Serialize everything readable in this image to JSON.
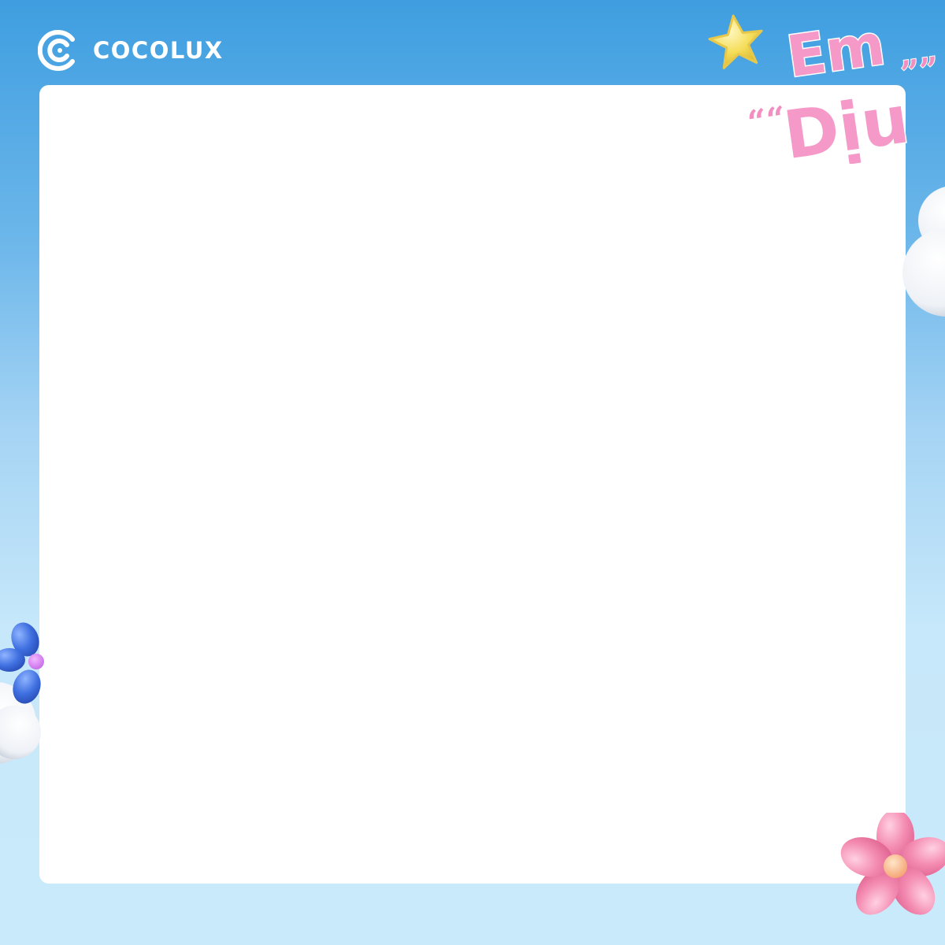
{
  "brand": {
    "name": "COCOLUX",
    "logo_icon": "cocolux-logo-icon"
  },
  "title": {
    "line1": "Em",
    "line2": "Dịu",
    "quote_open": "““",
    "quote_close": "””"
  },
  "colors": {
    "background_top": "#3f9ee0",
    "background_bottom": "#c9eafb",
    "card": "#ffffff",
    "title_pink": "#f59ac8",
    "star_yellow": "#f5de5a",
    "flower_blue": "#3f6fe0",
    "flower_pink": "#f48cb2"
  },
  "decorations": {
    "star": "star-icon",
    "pink_flower": "pink-flower-icon",
    "blue_flower": "blue-flower-icon",
    "cloud": "cloud-icon"
  }
}
